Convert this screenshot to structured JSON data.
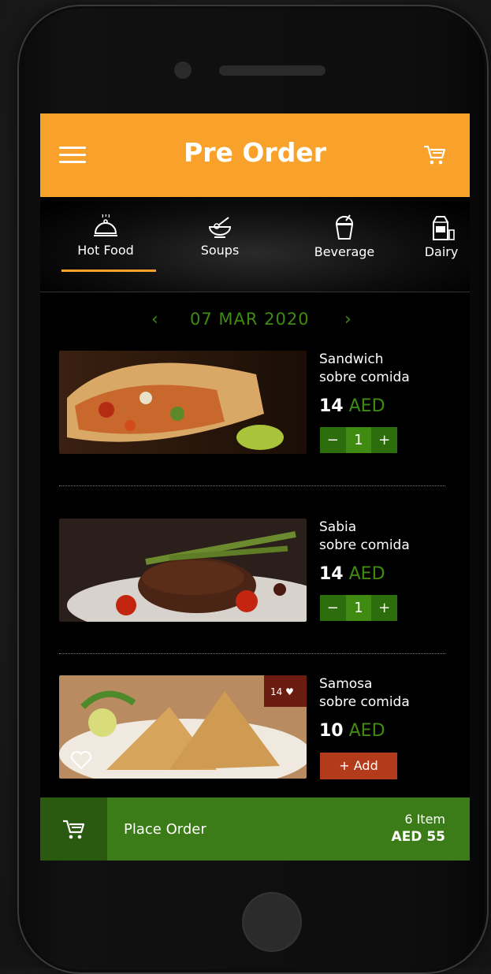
{
  "header": {
    "title": "Pre Order"
  },
  "categories": [
    {
      "label": "Hot Food",
      "icon": "cloche-icon",
      "active": true
    },
    {
      "label": "Soups",
      "icon": "soup-bowl-icon",
      "active": false
    },
    {
      "label": "Beverage",
      "icon": "beverage-cup-icon",
      "active": false
    },
    {
      "label": "Dairy",
      "icon": "milk-carton-icon",
      "active": false
    }
  ],
  "date": {
    "prev": "‹",
    "value": "07 MAR 2020",
    "next": "›"
  },
  "items": [
    {
      "name_line1": "Sandwich",
      "name_line2": "sobre comida",
      "price": "14",
      "currency": "AED",
      "qty": "1",
      "minus": "−",
      "plus": "+"
    },
    {
      "name_line1": "Sabia",
      "name_line2": "sobre comida",
      "price": "14",
      "currency": "AED",
      "qty": "1",
      "minus": "−",
      "plus": "+"
    },
    {
      "name_line1": "Samosa",
      "name_line2": "sobre comida",
      "price": "10",
      "currency": "AED",
      "add_label": "+ Add",
      "likes": "14"
    }
  ],
  "order": {
    "label": "Place Order",
    "count": "6 Item",
    "total": "AED 55"
  },
  "colors": {
    "header": "#f9a22b",
    "accent_green": "#3f8b12",
    "add_red": "#b33a1a"
  }
}
